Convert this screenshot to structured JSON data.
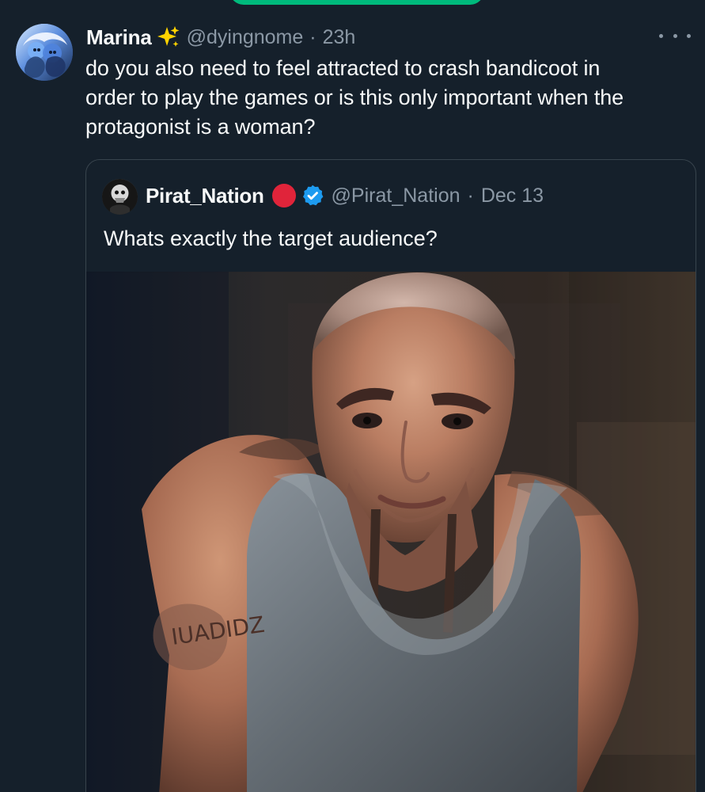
{
  "tweet": {
    "author_name": "Marina",
    "handle": "@dyingnome",
    "separator": "·",
    "time": "23h",
    "text": "do you also need to feel attracted to crash bandicoot in\norder to play the games or is this only important when the\nprotagonist is a woman?"
  },
  "quote": {
    "author_name": "Pirat_Nation",
    "handle": "@Pirat_Nation",
    "separator": "·",
    "date": "Dec 13",
    "text": "Whats exactly the target audience?"
  },
  "image": {
    "tattoo_text": "IUADIDZ"
  },
  "icons": {
    "sparkle": "sparkle-icon",
    "more": "more-options-icon",
    "verified": "verified-icon",
    "status": "red-circle-icon"
  },
  "colors": {
    "background": "#15202b",
    "text_primary": "#f7f9f9",
    "text_secondary": "#8b98a5",
    "border": "#38444d",
    "accent_green": "#00ba7c",
    "verified_blue": "#1d9bf0",
    "status_red": "#e0243a"
  }
}
